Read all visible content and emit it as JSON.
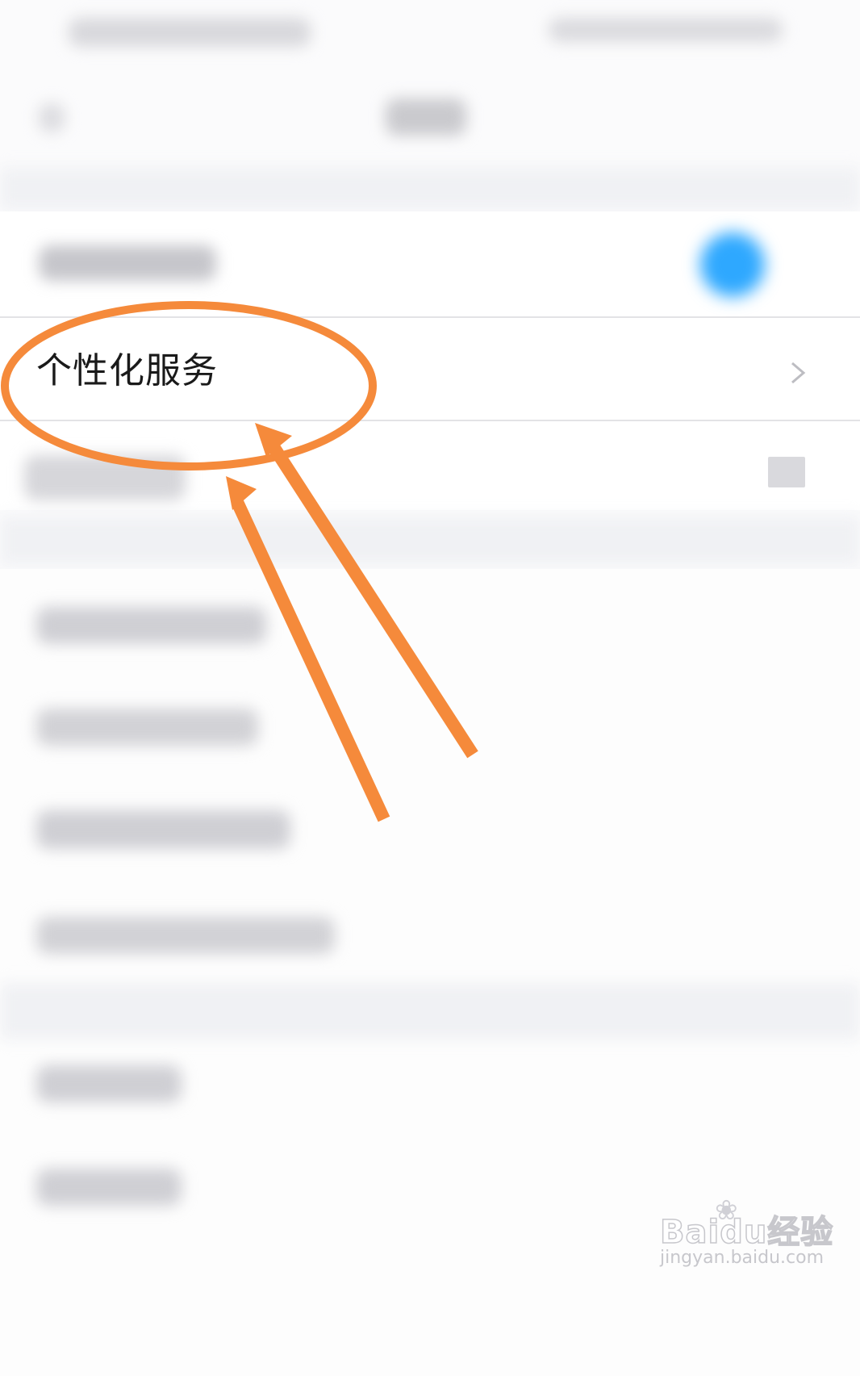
{
  "settings_list": {
    "highlighted_item": {
      "label": "个性化服务"
    }
  },
  "colors": {
    "annotation_orange": "#f58a3b",
    "toggle_blue": "#2ea8ff"
  },
  "icons": {
    "row_chevron": "chevron-right-icon"
  },
  "watermark": {
    "logo_text": "Baidu经验",
    "url": "jingyan.baidu.com"
  }
}
